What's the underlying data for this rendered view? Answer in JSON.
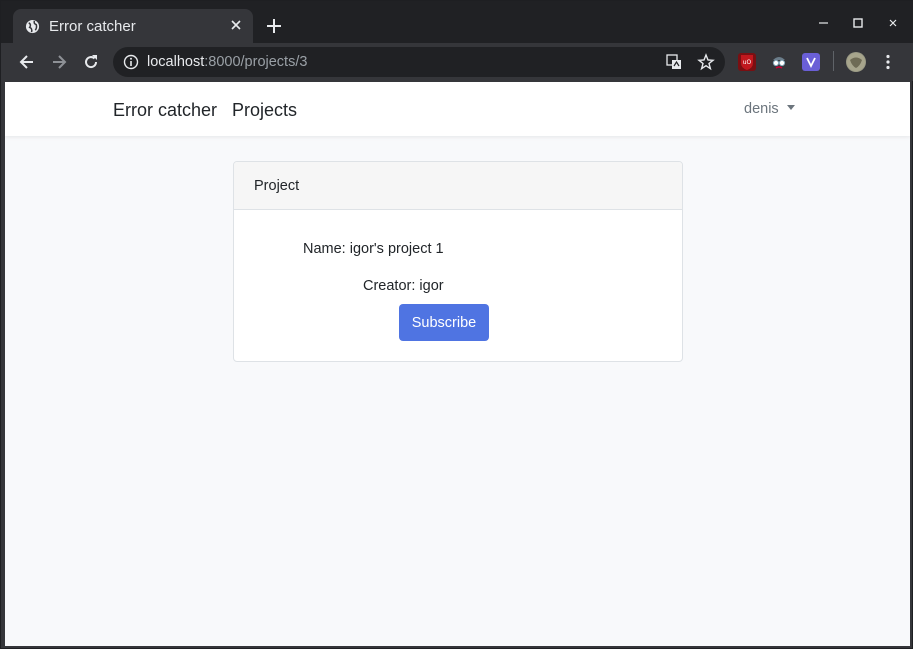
{
  "browser": {
    "tab": {
      "title": "Error catcher",
      "favicon": "globe-icon"
    },
    "address": {
      "host": "localhost",
      "path": ":8000/projects/3"
    },
    "icons": [
      "back-icon",
      "forward-icon",
      "reload-icon",
      "info-icon",
      "translate-icon",
      "bookmark-star-icon",
      "ublock-icon",
      "spy-extension-icon",
      "vue-extension-icon",
      "profile-avatar",
      "menu-dots-icon"
    ]
  },
  "navbar": {
    "brand": "Error catcher",
    "projects_link": "Projects",
    "user": "denis"
  },
  "card": {
    "header": "Project",
    "name_line": "Name: igor's project 1",
    "creator_line": "Creator: igor",
    "subscribe_label": "Subscribe"
  },
  "colors": {
    "primary_button": "#4f74e2",
    "page_background": "#f8f9fb",
    "chrome_dark": "#202124",
    "chrome_toolbar": "#35363a"
  }
}
